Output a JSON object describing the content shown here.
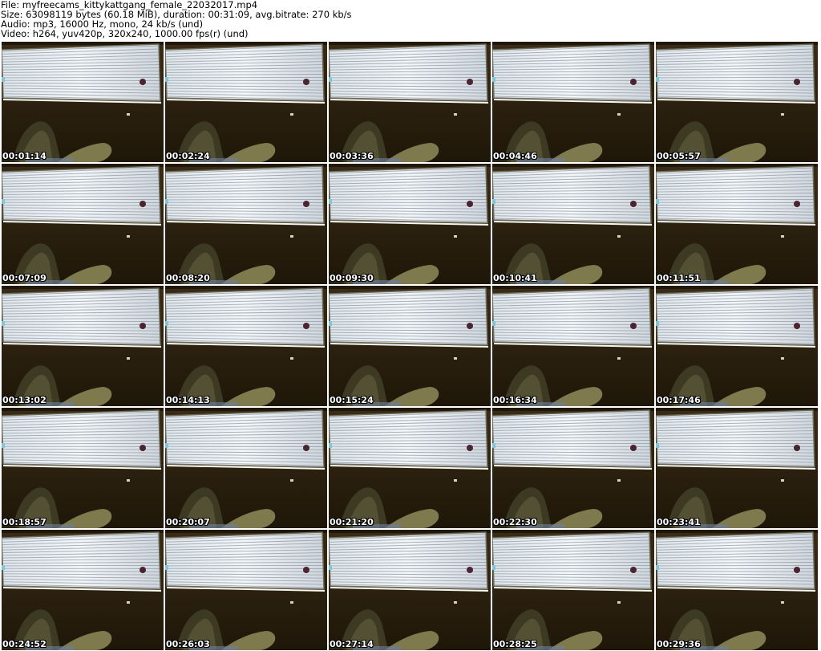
{
  "header": {
    "file_line": "File: myfreecams_kittykattgang_female_22032017.mp4",
    "size_line": "Size: 63098119 bytes (60.18 MiB), duration: 00:31:09, avg.bitrate: 270 kb/s",
    "audio_line": "Audio: mp3, 16000 Hz, mono, 24 kb/s (und)",
    "video_line": "Video: h264, yuv420p, 320x240, 1000.00 fps(r) (und)"
  },
  "thumbnails": [
    {
      "timestamp": "00:01:14"
    },
    {
      "timestamp": "00:02:24"
    },
    {
      "timestamp": "00:03:36"
    },
    {
      "timestamp": "00:04:46"
    },
    {
      "timestamp": "00:05:57"
    },
    {
      "timestamp": "00:07:09"
    },
    {
      "timestamp": "00:08:20"
    },
    {
      "timestamp": "00:09:30"
    },
    {
      "timestamp": "00:10:41"
    },
    {
      "timestamp": "00:11:51"
    },
    {
      "timestamp": "00:13:02"
    },
    {
      "timestamp": "00:14:13"
    },
    {
      "timestamp": "00:15:24"
    },
    {
      "timestamp": "00:16:34"
    },
    {
      "timestamp": "00:17:46"
    },
    {
      "timestamp": "00:18:57"
    },
    {
      "timestamp": "00:20:07"
    },
    {
      "timestamp": "00:21:20"
    },
    {
      "timestamp": "00:22:30"
    },
    {
      "timestamp": "00:23:41"
    },
    {
      "timestamp": "00:24:52"
    },
    {
      "timestamp": "00:26:03"
    },
    {
      "timestamp": "00:27:14"
    },
    {
      "timestamp": "00:28:25"
    },
    {
      "timestamp": "00:29:36"
    }
  ],
  "grid": {
    "columns": 5,
    "rows": 5
  }
}
